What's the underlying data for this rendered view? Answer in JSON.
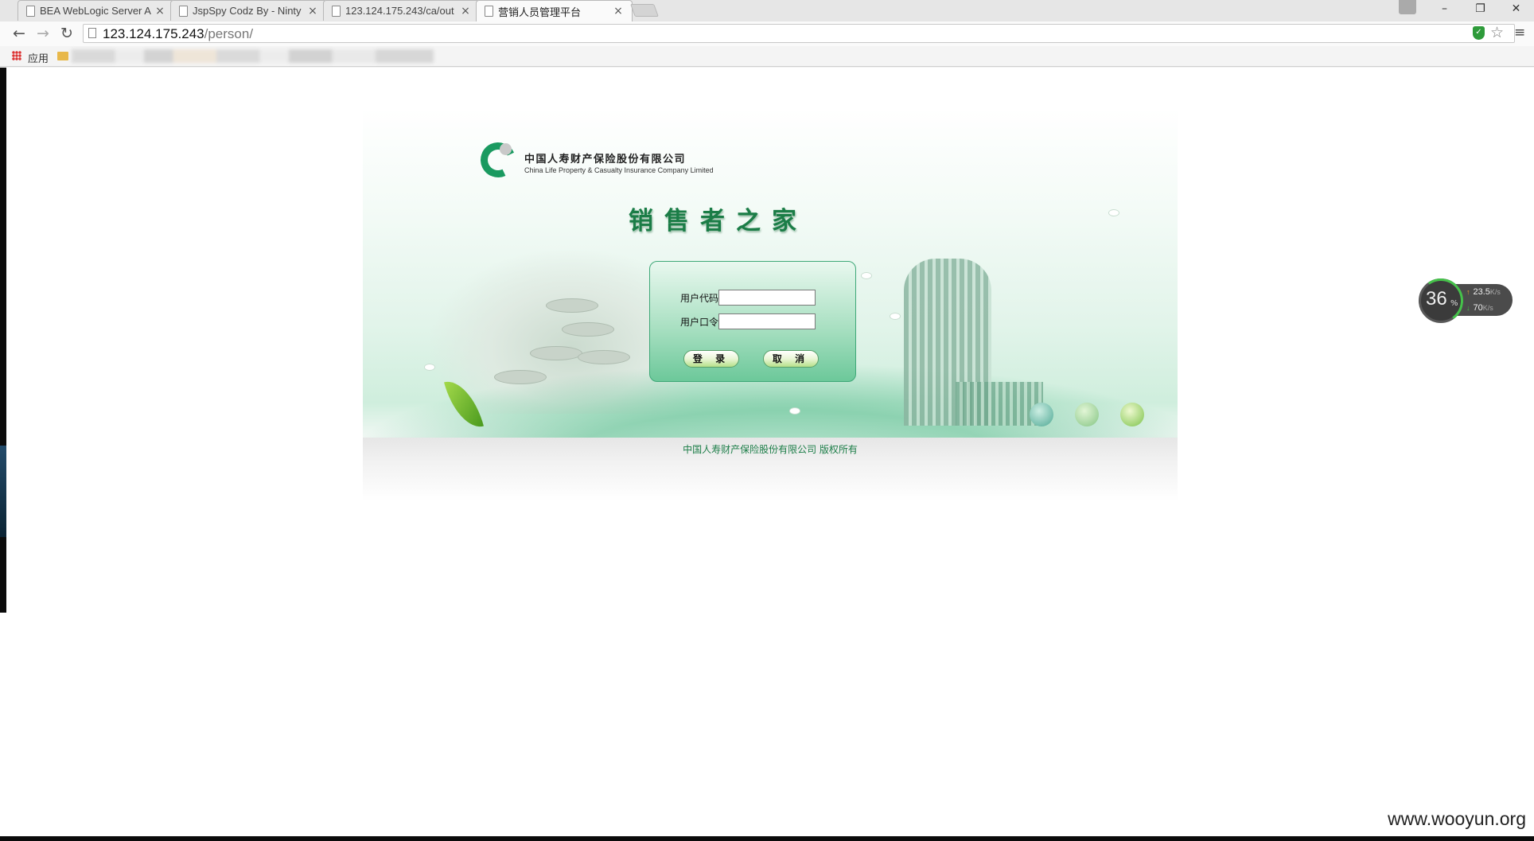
{
  "browser": {
    "tabs": [
      {
        "title": "BEA WebLogic Server Ad",
        "close": "×",
        "active": false
      },
      {
        "title": "JspSpy Codz By - Ninty",
        "close": "×",
        "active": false
      },
      {
        "title": "123.124.175.243/ca/out",
        "close": "×",
        "active": false
      },
      {
        "title": "营销人员管理平台",
        "close": "×",
        "active": true
      }
    ],
    "window_controls": {
      "minimize": "–",
      "restore": "❐",
      "close": "✕"
    },
    "nav": {
      "back": "←",
      "forward": "→",
      "reload": "↻"
    },
    "address": {
      "host": "123.124.175.243",
      "path": "/person/"
    },
    "star": "☆",
    "menu": "≡",
    "bookmarks": {
      "apps_label": "应用"
    }
  },
  "page": {
    "company_cn": "中国人寿财产保险股份有限公司",
    "company_en": "China Life Property & Casualty Insurance Company Limited",
    "site_title": "销售者之家",
    "login": {
      "user_code_label": "用户代码",
      "user_code_value": "",
      "password_label": "用户口令",
      "password_value": "",
      "login_button": "登 录",
      "cancel_button": "取 消"
    },
    "copyright": "中国人寿财产保险股份有限公司  版权所有"
  },
  "speed_widget": {
    "cpu_percent": "36",
    "cpu_unit": "%",
    "upload": "23.5",
    "download": "70",
    "unit": "K/s"
  },
  "watermark": "www.wooyun.org",
  "colors": {
    "brand_green": "#1b7d47",
    "panel_border": "#3fa878"
  }
}
